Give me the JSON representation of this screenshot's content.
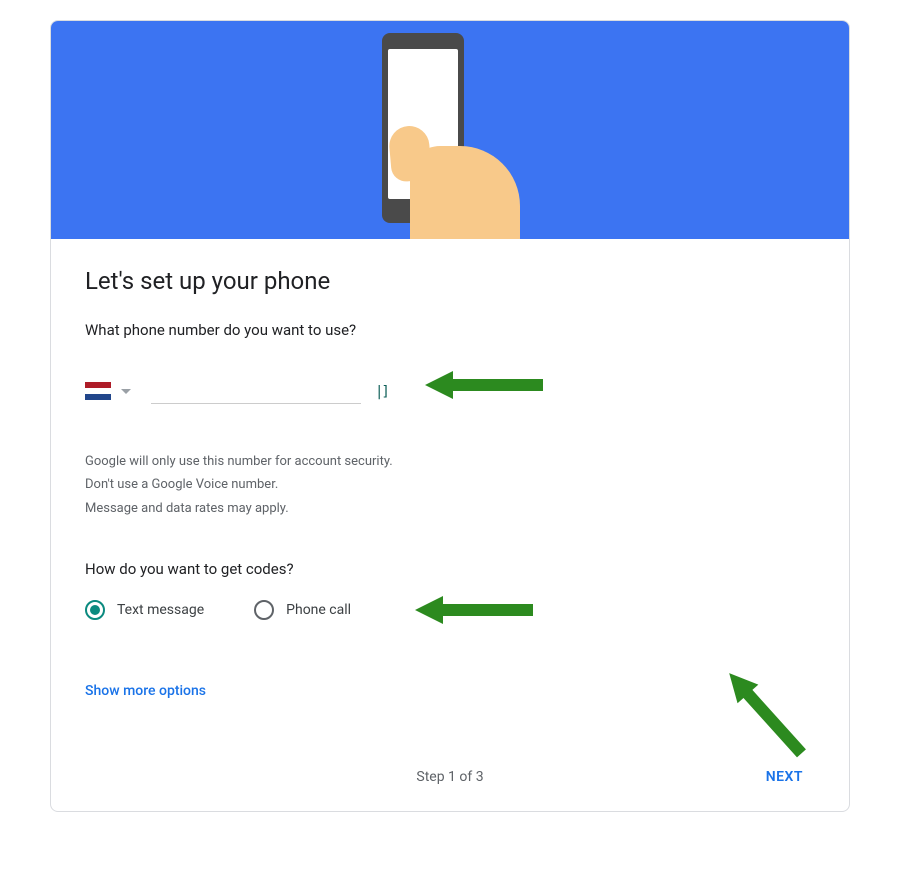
{
  "header": {
    "illustration": "hand-holding-phone"
  },
  "title": "Let's set up your phone",
  "phone_section": {
    "question": "What phone number do you want to use?",
    "country": "Netherlands",
    "phone_value": "",
    "phone_placeholder": "",
    "info_lines": [
      "Google will only use this number for account security.",
      "Don't use a Google Voice number.",
      "Message and data rates may apply."
    ]
  },
  "codes_section": {
    "question": "How do you want to get codes?",
    "options": [
      {
        "label": "Text message",
        "selected": true
      },
      {
        "label": "Phone call",
        "selected": false
      }
    ]
  },
  "more_options_label": "Show more options",
  "footer": {
    "step_text": "Step 1 of 3",
    "next_label": "NEXT"
  },
  "annotations": {
    "arrow_icon": "green-arrow"
  },
  "colors": {
    "banner": "#3c74f2",
    "accent": "#1a73e8",
    "radio_selected": "#0b8a7f",
    "arrow": "#2c8a1f"
  }
}
